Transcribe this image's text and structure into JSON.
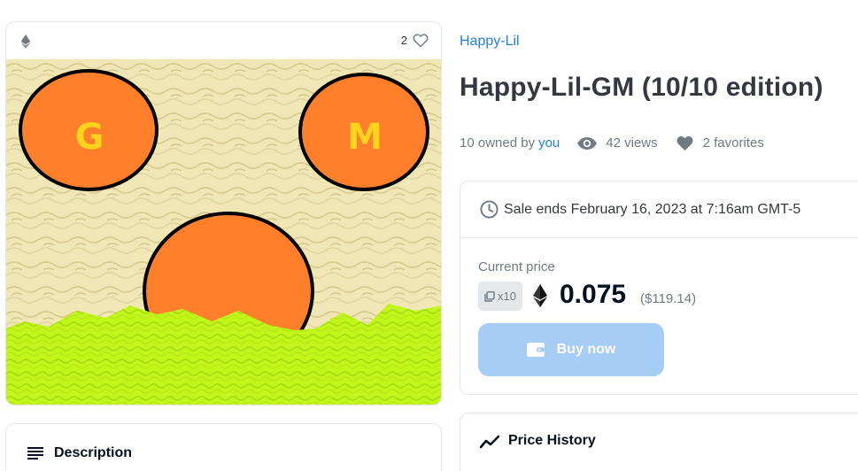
{
  "media": {
    "favorite_count": "2",
    "art_letters": [
      "G",
      "M"
    ]
  },
  "description": {
    "title": "Description"
  },
  "item": {
    "collection": "Happy-Lil",
    "title": "Happy-Lil-GM (10/10 edition)"
  },
  "stats": {
    "owned_prefix": "10 owned by",
    "owner": "you",
    "views": "42 views",
    "favorites": "2 favorites"
  },
  "sale": {
    "ends_text": "Sale ends February 16, 2023 at 7:16am GMT-5"
  },
  "price": {
    "label": "Current price",
    "quantity": "x10",
    "value": "0.075",
    "usd": "($119.14)",
    "buy_label": "Buy now"
  },
  "price_history": {
    "title": "Price History"
  },
  "colors": {
    "accent": "#2081e2",
    "buy_button": "#a6cdf6",
    "art_orange": "#ff7f2a",
    "art_letter": "#ffd41a",
    "art_grass": "#c2f51a",
    "art_background": "#f1e6b5"
  },
  "icons": {
    "chain": "ethereum-icon",
    "favorite": "heart-icon",
    "views": "eye-icon",
    "sale": "clock-icon",
    "buy": "wallet-icon",
    "description": "list-icon",
    "history": "trend-line-icon"
  }
}
